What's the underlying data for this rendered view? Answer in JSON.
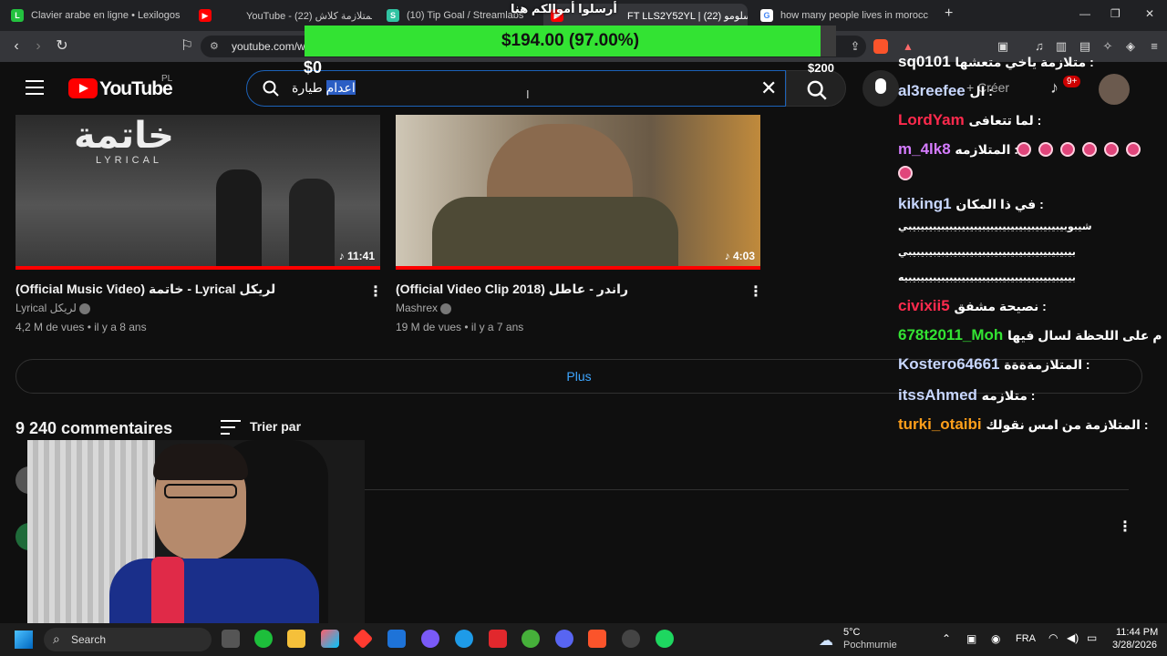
{
  "browser": {
    "tabs": [
      {
        "title": "Clavier arabe en ligne • Lexilogos",
        "color": "#23c23f"
      },
      {
        "title": "YouTube - (22) المتلازمة كلاش",
        "color": "#ff0000"
      },
      {
        "title": "(10) Tip Goal / Streamlabs",
        "color": "#31c3a2"
      },
      {
        "title": "FT LLS2Y52YL | (22) سلومو",
        "color": "#ff0000"
      },
      {
        "title": "how many people lives in morocco -",
        "color": "#4285f4"
      }
    ],
    "url": "youtube.com/w"
  },
  "goal": {
    "title": "أرسلوا أموالكم هنا",
    "amount_text": "$194.00 (97.00%)",
    "progress_fraction": 0.97,
    "min_label": "$0",
    "max_label": "$200"
  },
  "youtube": {
    "logo_text": "YouTube",
    "country": "PL",
    "search_highlight": "اعدام",
    "search_rest": "طيارة",
    "create_label": "Créer",
    "notif_count": "9+",
    "videos": [
      {
        "title": "(Official Music Video) خاتمة - Lyrical لريكل",
        "channel": "Lyrical لريكل",
        "meta": "4,2 M de vues • il y a 8 ans",
        "duration": "11:41",
        "thumb_text": "خاتمة",
        "thumb_sub": "LYRICAL"
      },
      {
        "title": "(Official Video Clip 2018) راندر - عاطل",
        "channel": "Mashrex",
        "meta": "19 M de vues • il y a 7 ans",
        "duration": "4:03"
      }
    ],
    "more_label": "Plus",
    "comments_count": "9 240 commentaires",
    "sort_label": "Trier par"
  },
  "chat": [
    {
      "user": "sq0101",
      "color": "#ffffff",
      "msg": "متلازمة ياخي متعشها :"
    },
    {
      "user": "al3reefee",
      "color": "#c8d7ff",
      "msg": "ال :"
    },
    {
      "user": "LordYam",
      "color": "#ff2a4d",
      "msg": "لما تتعافى :"
    },
    {
      "user": "m_4lk8",
      "color": "#d57cff",
      "msg": "المتلازمه :"
    },
    {
      "user": "kiking1",
      "color": "#c8d7ff",
      "msg": "في ذا المكان :"
    },
    {
      "user": "",
      "color": "#ffffff",
      "msg": "شيبوبيبيبيبيبيبيبيبيبيبيبيبيبيبيبيبيبيبيبيبي"
    },
    {
      "user": "",
      "color": "#ffffff",
      "msg": "بيبيبيبيبيبيبيبيبيبيبيبيبيبيبيبيبيبيبيبيبي"
    },
    {
      "user": "",
      "color": "#ffffff",
      "msg": "بيبيبيبيبيبيبيبيبيبيبيبيبيبيبيبيبيبيبيبيبيه"
    },
    {
      "user": "civixii5",
      "color": "#ff2a4d",
      "msg": "نصيحة مشفق :"
    },
    {
      "user": "678t2011_Moh",
      "color": "#33e333",
      "msg": "ندم على اللحظة لسال فيها :"
    },
    {
      "user": "Kostero64661",
      "color": "#c8d7ff",
      "msg": "المتلازمةةةة :"
    },
    {
      "user": "itssAhmed",
      "color": "#c8d7ff",
      "msg": "متلازمه :"
    },
    {
      "user": "turki_otaibi",
      "color": "#ff9f1a",
      "msg": "المتلازمة من امس نقولك :"
    }
  ],
  "taskbar": {
    "search_label": "Search",
    "weather_temp": "5°C",
    "weather_place": "Pochmurnie",
    "lang": "FRA",
    "time": "11:44 PM",
    "date": "3/28/2026"
  }
}
